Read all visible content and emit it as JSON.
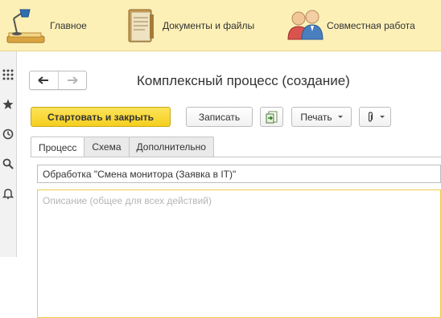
{
  "top_nav": {
    "items": [
      {
        "label": "Главное",
        "icon": "desk-lamp-icon"
      },
      {
        "label": "Документы и файлы",
        "icon": "document-folder-icon"
      },
      {
        "label": "Совместная работа",
        "icon": "users-icon"
      }
    ]
  },
  "left_panel": {
    "icons": [
      "apps-grid-icon",
      "star-icon",
      "history-icon",
      "search-icon",
      "bell-icon"
    ]
  },
  "form": {
    "title": "Комплексный процесс (создание)",
    "toolbar": {
      "start_close_label": "Стартовать и закрыть",
      "save_label": "Записать",
      "print_label": "Печать",
      "doc_icon": "document-arrow-icon",
      "attach_icon": "paperclip-icon"
    },
    "tabs": [
      {
        "label": "Процесс",
        "active": true
      },
      {
        "label": "Схема",
        "active": false
      },
      {
        "label": "Дополнительно",
        "active": false
      }
    ],
    "subject_value": "Обработка \"Смена монитора (Заявка в IT)\"",
    "description_placeholder": "Описание (общее для всех действий)"
  },
  "colors": {
    "topbar_bg": "#fcf0b7",
    "primary_button": "#f5cf1e",
    "focus_border": "#f0c94b"
  }
}
